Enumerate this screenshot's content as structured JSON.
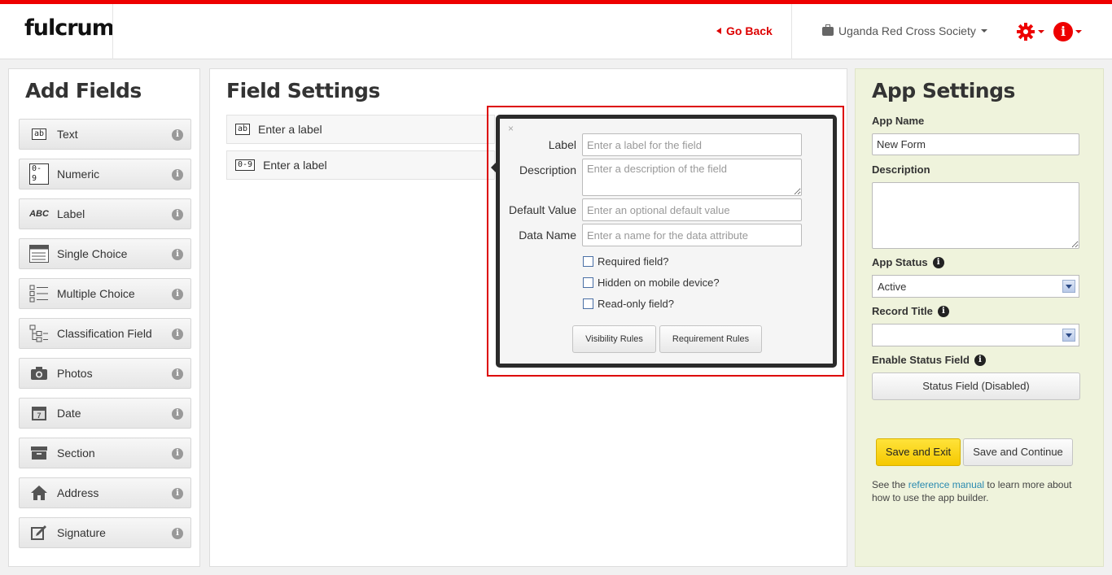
{
  "header": {
    "logo": "fulcrum",
    "go_back": "Go Back",
    "organization": "Uganda Red Cross Society"
  },
  "add_fields": {
    "title": "Add Fields",
    "items": [
      {
        "label": "Text",
        "icon": "text-field-icon"
      },
      {
        "label": "Numeric",
        "icon": "numeric-field-icon"
      },
      {
        "label": "Label",
        "icon": "label-field-icon"
      },
      {
        "label": "Single Choice",
        "icon": "single-choice-icon"
      },
      {
        "label": "Multiple Choice",
        "icon": "multiple-choice-icon"
      },
      {
        "label": "Classification Field",
        "icon": "classification-icon"
      },
      {
        "label": "Photos",
        "icon": "camera-icon"
      },
      {
        "label": "Date",
        "icon": "calendar-icon"
      },
      {
        "label": "Section",
        "icon": "section-icon"
      },
      {
        "label": "Address",
        "icon": "home-icon"
      },
      {
        "label": "Signature",
        "icon": "signature-icon"
      }
    ],
    "icon_tags": {
      "text": "ab",
      "numeric": "0-9",
      "label": "ABC"
    }
  },
  "field_settings": {
    "title": "Field Settings",
    "rows": [
      {
        "tag": "ab",
        "label": "Enter a label"
      },
      {
        "tag": "0-9",
        "label": "Enter a label"
      }
    ]
  },
  "popover": {
    "close": "×",
    "label_label": "Label",
    "label_placeholder": "Enter a label for the field",
    "description_label": "Description",
    "description_placeholder": "Enter a description of the field",
    "default_label": "Default Value",
    "default_placeholder": "Enter an optional default value",
    "data_name_label": "Data Name",
    "data_name_placeholder": "Enter a name for the data attribute",
    "required": "Required field?",
    "hidden": "Hidden on mobile device?",
    "readonly": "Read-only field?",
    "visibility_rules": "Visibility Rules",
    "requirement_rules": "Requirement Rules"
  },
  "app_settings": {
    "title": "App Settings",
    "app_name_label": "App Name",
    "app_name_value": "New Form",
    "description_label": "Description",
    "app_status_label": "App Status",
    "app_status_value": "Active",
    "record_title_label": "Record Title",
    "record_title_value": "",
    "status_field_label": "Enable Status Field",
    "status_field_button": "Status Field (Disabled)",
    "save_exit": "Save and Exit",
    "save_continue": "Save and Continue",
    "note_prefix": "See the ",
    "note_link": "reference manual",
    "note_suffix": " to learn more about how to use the app builder."
  },
  "colors": {
    "accent": "#dd0000",
    "save_exit": "#f5c800",
    "right_panel": "#eff3dc"
  }
}
